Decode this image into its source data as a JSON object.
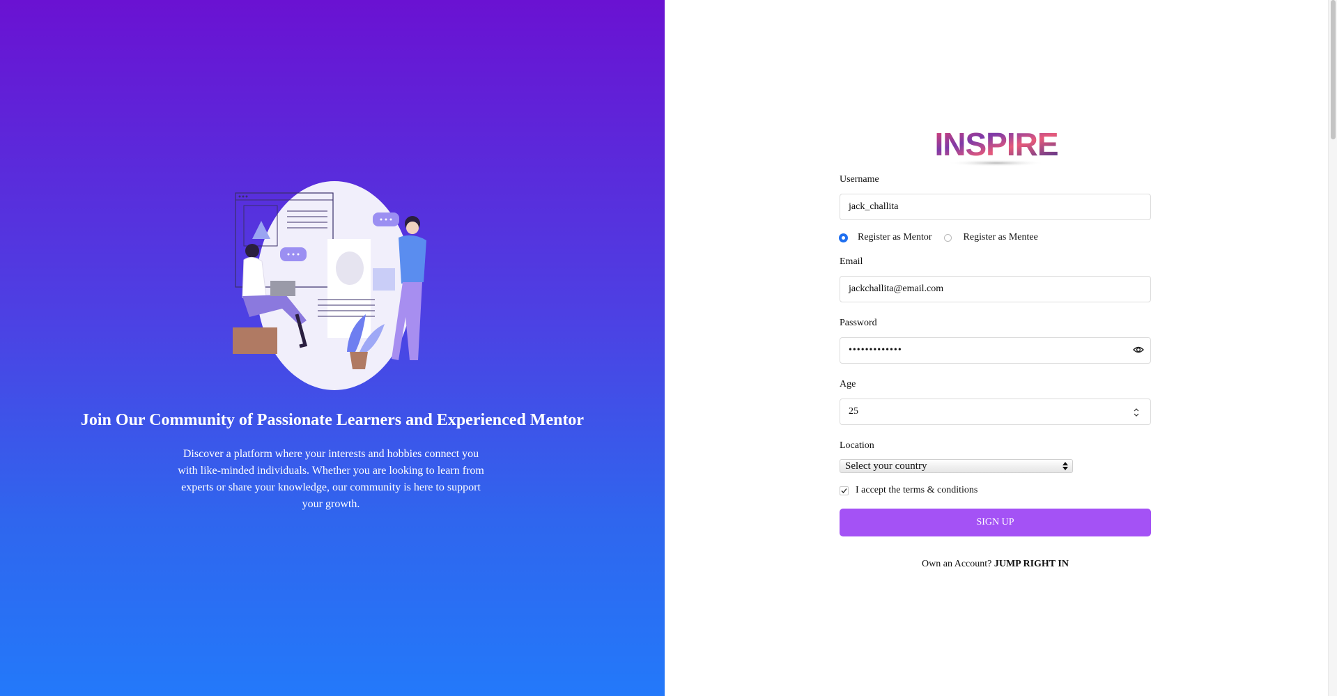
{
  "left": {
    "headline": "Join Our Community of Passionate Learners and Experienced Mentor",
    "description": "Discover a platform where your interests and hobbies connect you with like-minded individuals. Whether you are looking to learn from experts or share your knowledge, our community is here to support your growth."
  },
  "logo": {
    "text": "INSPIRE"
  },
  "form": {
    "username_label": "Username",
    "username_value": "jack_challita",
    "role_mentor_label": "Register as Mentor",
    "role_mentee_label": "Register as Mentee",
    "role_selected": "mentor",
    "email_label": "Email",
    "email_value": "jackchallita@email.com",
    "password_label": "Password",
    "password_value": "•••••••••••••",
    "age_label": "Age",
    "age_value": "25",
    "location_label": "Location",
    "location_selected": "Select your country",
    "terms_label": "I accept the terms & conditions",
    "terms_checked": true,
    "signup_label": "SIGN UP",
    "login_prompt": "Own an Account?",
    "login_link": "JUMP RIGHT IN"
  },
  "colors": {
    "gradient_top": "#6a12d2",
    "gradient_bottom": "#2379fa",
    "button": "#a452f5",
    "radio_active": "#1f6ff0"
  }
}
